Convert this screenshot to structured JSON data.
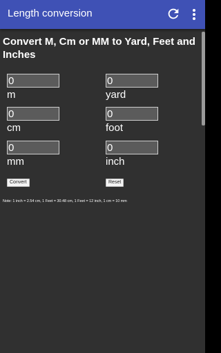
{
  "app_bar": {
    "title": "Length conversion",
    "color": "#3f51b5",
    "refresh_icon": "refresh-icon",
    "menu_icon": "more-vert-icon"
  },
  "page": {
    "heading": "Convert M, Cm or MM to Yard, Feet and Inches"
  },
  "fields": {
    "m": {
      "value": "0",
      "unit": "m"
    },
    "cm": {
      "value": "0",
      "unit": "cm"
    },
    "mm": {
      "value": "0",
      "unit": "mm"
    },
    "yard": {
      "value": "0",
      "unit": "yard"
    },
    "foot": {
      "value": "0",
      "unit": "foot"
    },
    "inch": {
      "value": "0",
      "unit": "inch"
    }
  },
  "buttons": {
    "convert_label": "Convert",
    "reset_label": "Reset"
  },
  "note": "Note: 1 inch = 2.54 cm, 1 Feet = 30.48 cm, 1 Feet = 12 inch, 1 cm = 10 mm"
}
